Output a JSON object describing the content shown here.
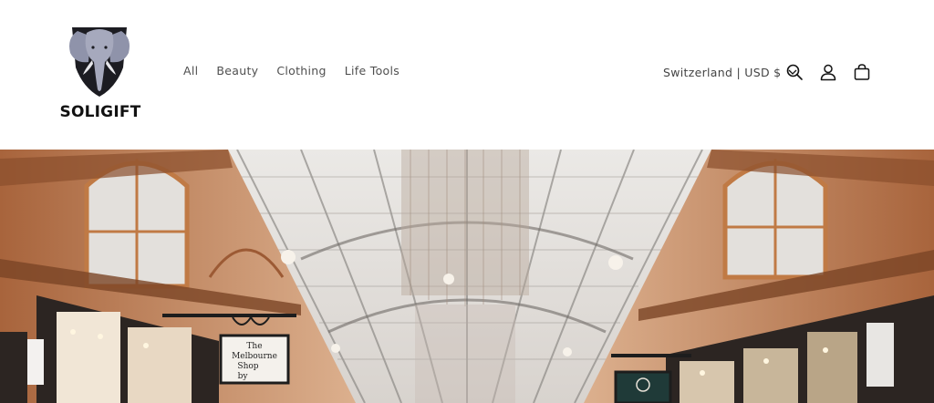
{
  "brand": {
    "name": "SOLIGIFT",
    "logo_icon": "elephant-shield-icon"
  },
  "nav": {
    "items": [
      {
        "label": "All"
      },
      {
        "label": "Beauty"
      },
      {
        "label": "Clothing"
      },
      {
        "label": "Life Tools"
      }
    ]
  },
  "localization": {
    "label": "Switzerland | USD $",
    "icon": "chevron-down-icon"
  },
  "header_icons": {
    "search": "search-icon",
    "account": "account-icon",
    "cart": "cart-icon"
  },
  "hero": {
    "sign_text": "The Melbourne Shop by"
  },
  "colors": {
    "text": "#121212",
    "header_bg": "#ffffff",
    "hero_warm": "#c98a5c",
    "hero_glass": "#e9e6e2"
  }
}
